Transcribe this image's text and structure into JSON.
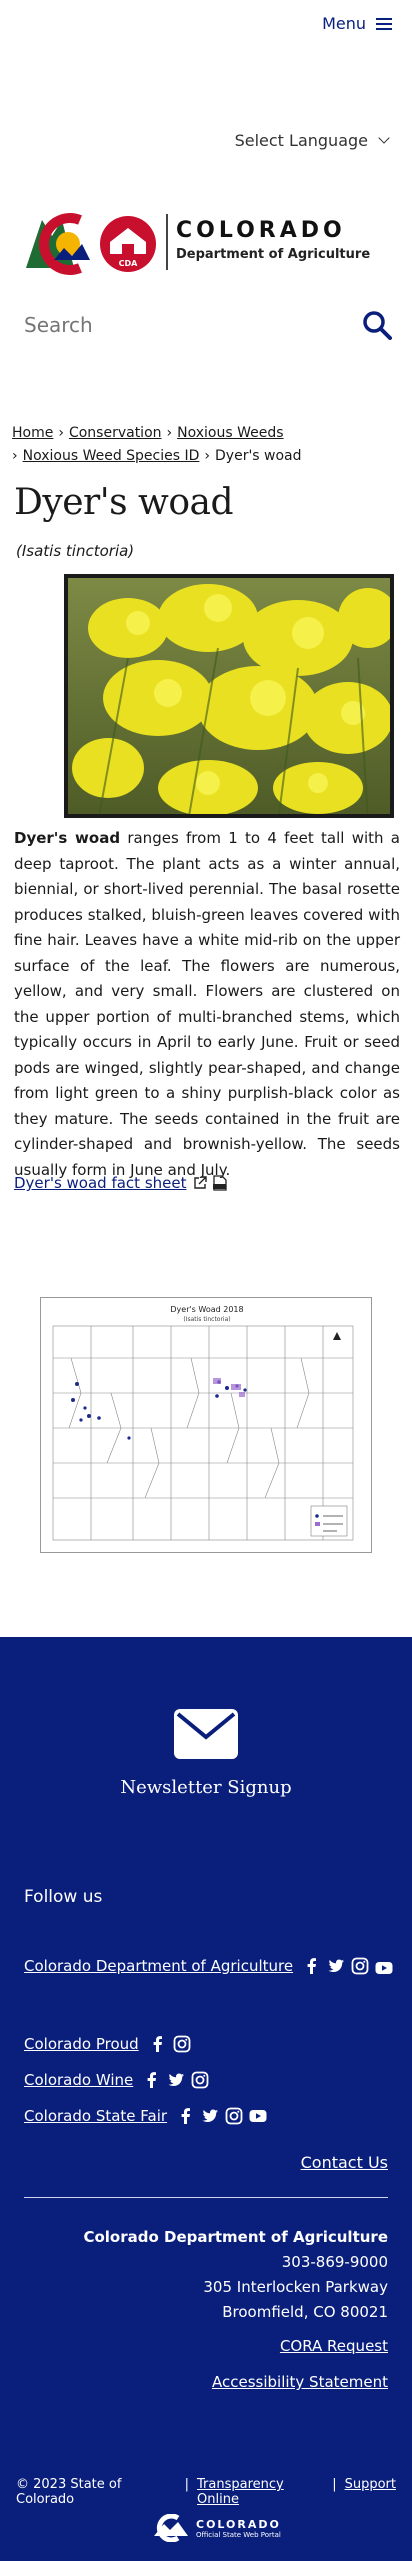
{
  "header": {
    "menu_label": "Menu",
    "language_label": "Select Language"
  },
  "logo": {
    "title": "COLORADO",
    "subtitle": "Department of Agriculture",
    "badge": "CDA"
  },
  "search": {
    "placeholder": "Search"
  },
  "breadcrumb": {
    "items": [
      "Home",
      "Conservation",
      "Noxious Weeds",
      "Noxious Weed Species ID"
    ],
    "current": "Dyer's woad"
  },
  "page": {
    "title": "Dyer's woad",
    "scientific_name": "(Isatis tinctoria)",
    "description_lead": "Dyer's woad",
    "description_body": " ranges from 1 to 4 feet tall with a deep taproot. The plant acts as a winter annual, biennial, or short-lived perennial. The basal rosette produces stalked, bluish-green leaves covered with fine hair. Leaves have a white mid-rib on the upper surface of the leaf. The flowers are numerous, yellow, and very small. Flowers are clustered on the upper portion of multi-branched stems, which typically occurs in April to early June. Fruit or seed pods are winged, slightly pear-shaped, and change from light green to a shiny purplish-black color as they mature. The seeds contained in the fruit are cylinder-shaped and brownish-yellow. The seeds usually form in June and July.",
    "factsheet_label": "Dyer's woad fact sheet",
    "map_title": "Dyer's Woad 2018",
    "map_subtitle": "(Isatis tinctoria)"
  },
  "footer": {
    "newsletter_label": "Newsletter Signup",
    "follow_label": "Follow us",
    "social_rows": [
      {
        "label": "Colorado Department of Agriculture"
      },
      {
        "label": "Colorado Proud"
      },
      {
        "label": "Colorado Wine"
      },
      {
        "label": "Colorado State Fair"
      }
    ],
    "contact_label": "Contact Us",
    "org_name": "Colorado Department of Agriculture",
    "phone": "303-869-9000",
    "street": "305 Interlocken Parkway",
    "city": "Broomfield, CO 80021",
    "cora_label": "CORA Request",
    "accessibility_label": "Accessibility Statement",
    "copyright": "© 2023 State of Colorado",
    "transparency_label": "Transparency Online",
    "support_label": "Support",
    "state_logo_word": "COLORADO",
    "state_logo_sub": "Official State Web Portal"
  },
  "colors": {
    "brand_blue": "#0a1f7c",
    "flower_yellow": "#e8e020"
  }
}
